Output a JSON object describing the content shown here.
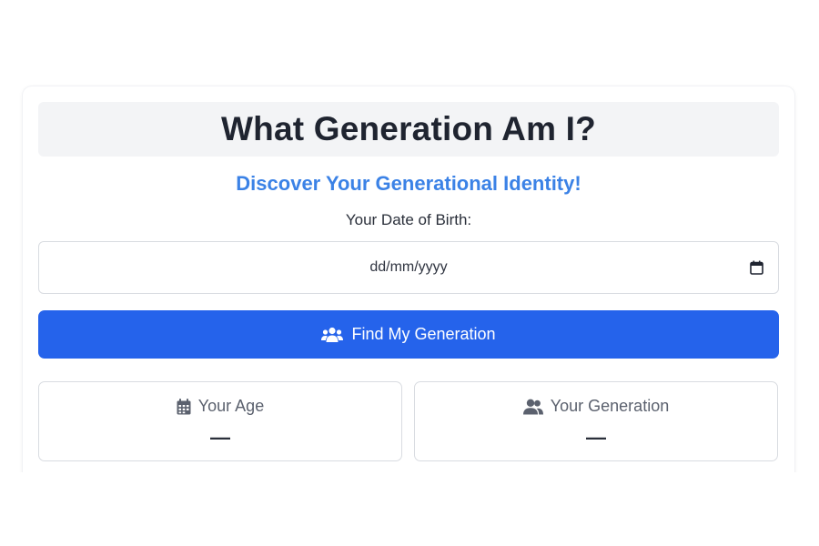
{
  "title": "What Generation Am I?",
  "subtitle": "Discover Your Generational Identity!",
  "form": {
    "dob_label": "Your Date of Birth:",
    "dob_placeholder": "dd/mm/yyyy",
    "calendar_icon": "calendar-icon",
    "button_label": "Find My Generation",
    "button_icon": "users-icon"
  },
  "results": {
    "age": {
      "label": "Your Age",
      "icon": "calendar-icon",
      "value": "—"
    },
    "generation": {
      "label": "Your Generation",
      "icon": "user-group-icon",
      "value": "—"
    }
  },
  "colors": {
    "accent": "#2563eb",
    "subtitle": "#3b82e6",
    "title_bg": "#f3f4f6",
    "title_text": "#1f2430"
  }
}
